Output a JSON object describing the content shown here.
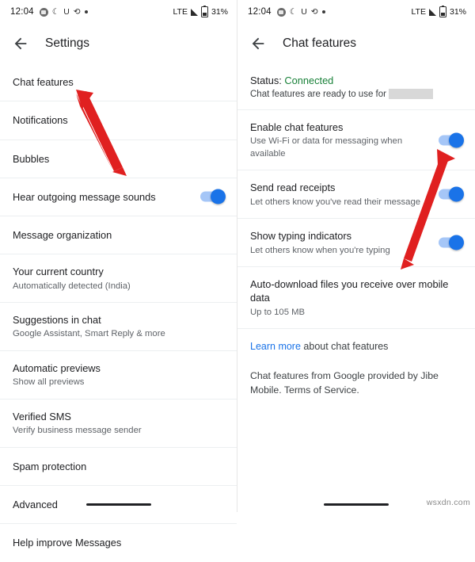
{
  "left_screen": {
    "status_bar": {
      "time": "12:04",
      "left_icons": [
        "circle-avatar-icon",
        "moon-icon",
        "letter-u-icon",
        "undo-arrow-icon",
        "dot-icon"
      ],
      "network": "LTE",
      "signal_icon": "signal-bars-icon",
      "battery_icon": "battery-icon",
      "battery_percent": "31%"
    },
    "appbar": {
      "back_icon": "back-arrow-icon",
      "title": "Settings"
    },
    "items": [
      {
        "title": "Chat features",
        "sub": "",
        "toggle": null
      },
      {
        "title": "Notifications",
        "sub": "",
        "toggle": null
      },
      {
        "title": "Bubbles",
        "sub": "",
        "toggle": null
      },
      {
        "title": "Hear outgoing message sounds",
        "sub": "",
        "toggle": true
      },
      {
        "title": "Message organization",
        "sub": "",
        "toggle": null
      },
      {
        "title": "Your current country",
        "sub": "Automatically detected (India)",
        "toggle": null
      },
      {
        "title": "Suggestions in chat",
        "sub": "Google Assistant, Smart Reply & more",
        "toggle": null
      },
      {
        "title": "Automatic previews",
        "sub": "Show all previews",
        "toggle": null
      },
      {
        "title": "Verified SMS",
        "sub": "Verify business message sender",
        "toggle": null
      },
      {
        "title": "Spam protection",
        "sub": "",
        "toggle": null
      },
      {
        "title": "Advanced",
        "sub": "",
        "toggle": null
      },
      {
        "title": "Help improve Messages",
        "sub": "",
        "toggle": null
      }
    ]
  },
  "right_screen": {
    "status_bar": {
      "time": "12:04",
      "left_icons": [
        "circle-avatar-icon",
        "moon-icon",
        "letter-u-icon",
        "undo-arrow-icon",
        "dot-icon"
      ],
      "network": "LTE",
      "signal_icon": "signal-bars-icon",
      "battery_icon": "battery-icon",
      "battery_percent": "31%"
    },
    "appbar": {
      "back_icon": "back-arrow-icon",
      "title": "Chat features"
    },
    "status": {
      "label": "Status:",
      "value": "Connected",
      "description": "Chat features are ready to use for"
    },
    "items": [
      {
        "title": "Enable chat features",
        "sub": "Use Wi-Fi or data for messaging when available",
        "toggle": true
      },
      {
        "title": "Send read receipts",
        "sub": "Let others know you've read their message",
        "toggle": true
      },
      {
        "title": "Show typing indicators",
        "sub": "Let others know when you're typing",
        "toggle": true
      },
      {
        "title": "Auto-download files you receive over mobile data",
        "sub": "Up to 105 MB",
        "toggle": null
      }
    ],
    "learn_more": {
      "link": "Learn more",
      "rest": " about chat features"
    },
    "footer": "Chat features from Google provided by Jibe Mobile. Terms of Service."
  },
  "annotations": {
    "arrow_color": "#e02020",
    "arrow_left_target": "chat-features-row",
    "arrow_right_target": "enable-chat-features-toggle"
  },
  "watermark": "wsxdn.com"
}
